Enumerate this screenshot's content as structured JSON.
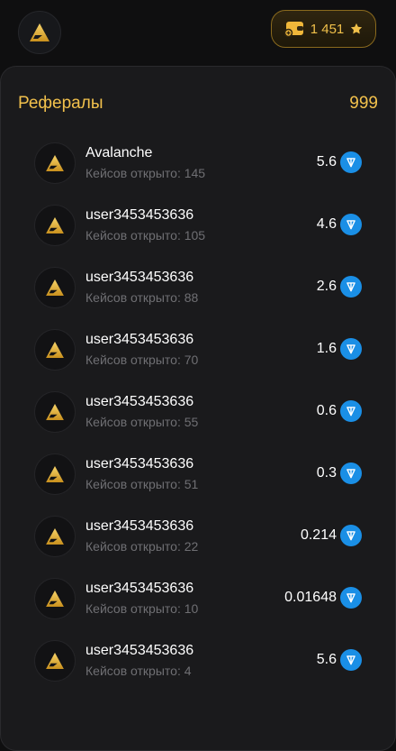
{
  "header": {
    "balance": "1 451",
    "brand_color": "#f2c14c",
    "logo_icon": "avalanche-logo-icon",
    "wallet_icon": "wallet-add-icon",
    "star_icon": "star-icon"
  },
  "referrals": {
    "title": "Рефералы",
    "count": "999",
    "items": [
      {
        "name": "Avalanche",
        "sub": "Кейсов открыто: 145",
        "amount": "5.6"
      },
      {
        "name": "user3453453636",
        "sub": "Кейсов открыто: 105",
        "amount": "4.6"
      },
      {
        "name": "user3453453636",
        "sub": "Кейсов открыто: 88",
        "amount": "2.6"
      },
      {
        "name": "user3453453636",
        "sub": "Кейсов открыто: 70",
        "amount": "1.6"
      },
      {
        "name": "user3453453636",
        "sub": "Кейсов открыто: 55",
        "amount": "0.6"
      },
      {
        "name": "user3453453636",
        "sub": "Кейсов открыто: 51",
        "amount": "0.3"
      },
      {
        "name": "user3453453636",
        "sub": "Кейсов открыто: 22",
        "amount": "0.214"
      },
      {
        "name": "user3453453636",
        "sub": "Кейсов открыто: 10",
        "amount": "0.01648"
      },
      {
        "name": "user3453453636",
        "sub": "Кейсов открыто: 4",
        "amount": "5.6"
      }
    ],
    "currency_icon": "ton-icon",
    "currency_color": "#1a8fe6"
  }
}
